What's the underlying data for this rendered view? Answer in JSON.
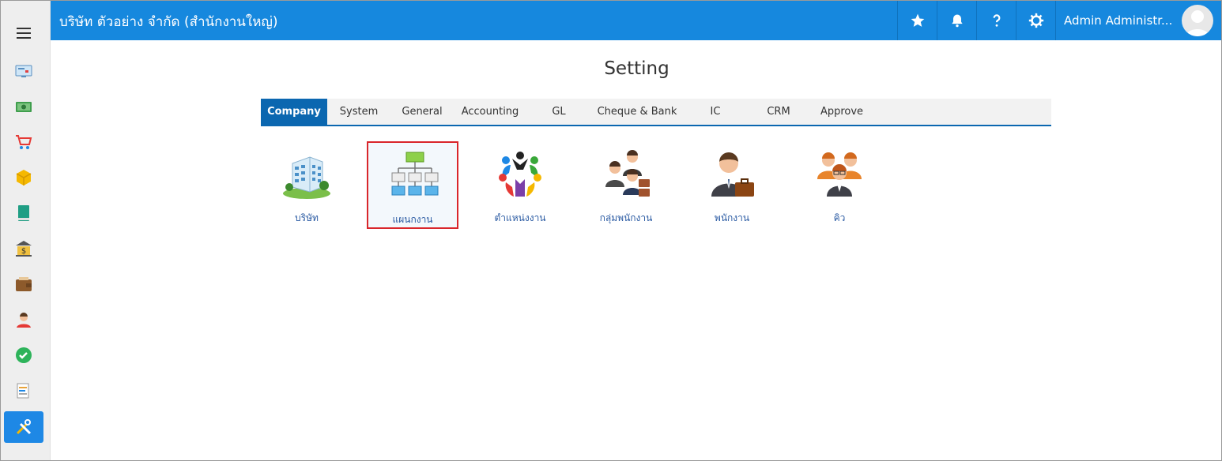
{
  "header": {
    "company": "บริษัท ตัวอย่าง จำกัด (สำนักงานใหญ่)",
    "user_name": "Admin Administr..."
  },
  "page": {
    "title": "Setting"
  },
  "tabs": [
    {
      "label": "Company",
      "active": true
    },
    {
      "label": "System"
    },
    {
      "label": "General"
    },
    {
      "label": "Accounting"
    },
    {
      "label": "GL"
    },
    {
      "label": "Cheque & Bank"
    },
    {
      "label": "IC"
    },
    {
      "label": "CRM"
    },
    {
      "label": "Approve"
    }
  ],
  "tiles": [
    {
      "label": "บริษัท",
      "icon": "building-icon"
    },
    {
      "label": "แผนกงาน",
      "icon": "org-chart-icon",
      "selected": true
    },
    {
      "label": "ตำแหน่งงาน",
      "icon": "people-circle-icon"
    },
    {
      "label": "กลุ่มพนักงาน",
      "icon": "employee-group-icon"
    },
    {
      "label": "พนักงาน",
      "icon": "employee-icon"
    },
    {
      "label": "คิว",
      "icon": "queue-icon"
    }
  ],
  "sidebar": {
    "icons": [
      "dashboard-icon",
      "money-icon",
      "cart-icon",
      "box-icon",
      "book-icon",
      "bank-icon",
      "wallet-icon",
      "person-icon",
      "check-icon",
      "report-icon",
      "tools-icon"
    ]
  },
  "colors": {
    "topbar": "#1688de",
    "tab_active": "#0b67b0",
    "selection_border": "#d9262b",
    "link": "#2b5ba3"
  }
}
